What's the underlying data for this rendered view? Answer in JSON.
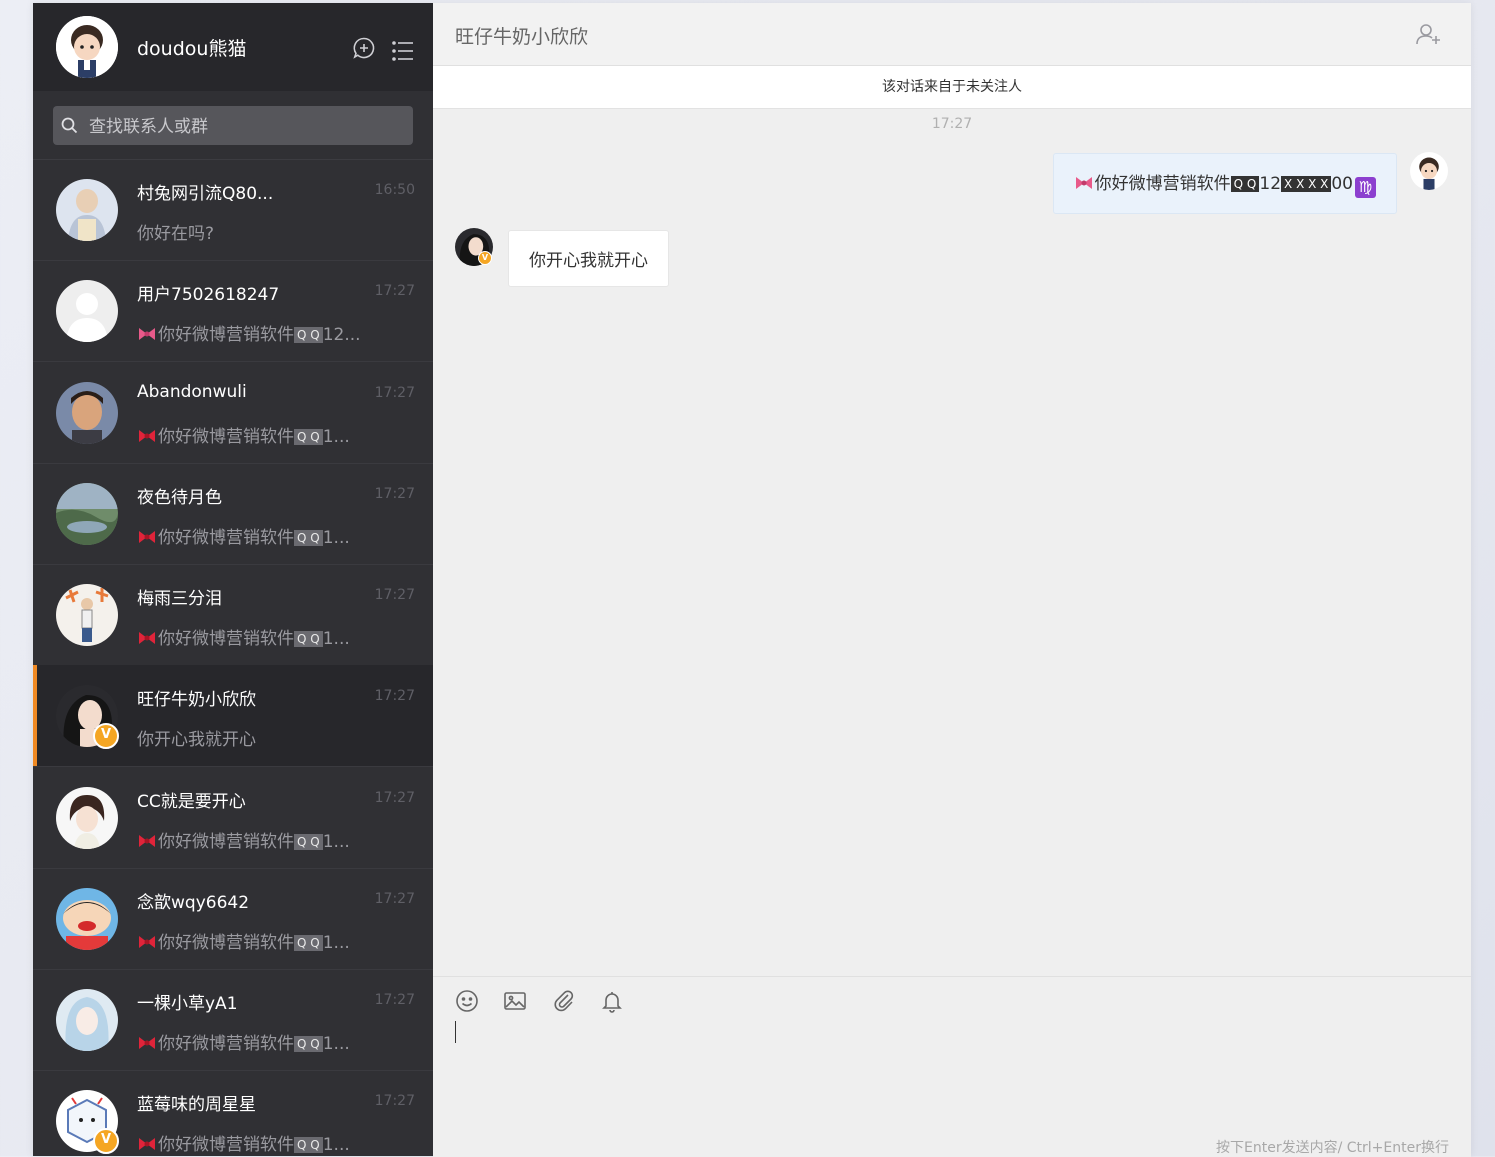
{
  "profile": {
    "name": "doudou熊猫"
  },
  "search": {
    "placeholder": "查找联系人或群"
  },
  "conversations": [
    {
      "name": "村兔网引流Q80...",
      "time": "16:50",
      "preview": "你好在吗?"
    },
    {
      "name": "用户7502618247",
      "time": "17:27",
      "preview": "你好微博营销软件",
      "preview_code": "Q Q",
      "preview_tail": "12..."
    },
    {
      "name": "Abandonwuli",
      "time": "17:27",
      "preview": "你好微博营销软件",
      "preview_code": "Q Q",
      "preview_tail": "1..."
    },
    {
      "name": "夜色待月色",
      "time": "17:27",
      "preview": "你好微博营销软件",
      "preview_code": "Q Q",
      "preview_tail": "1..."
    },
    {
      "name": "梅雨三分泪",
      "time": "17:27",
      "preview": "你好微博营销软件",
      "preview_code": "Q Q",
      "preview_tail": "1..."
    },
    {
      "name": "旺仔牛奶小欣欣",
      "time": "17:27",
      "preview": "你开心我就开心",
      "active": true,
      "verified": true
    },
    {
      "name": "CC就是要开心",
      "time": "17:27",
      "preview": "你好微博营销软件",
      "preview_code": "Q Q",
      "preview_tail": "1..."
    },
    {
      "name": "念歆wqy6642",
      "time": "17:27",
      "preview": "你好微博营销软件",
      "preview_code": "Q Q",
      "preview_tail": "1..."
    },
    {
      "name": "一棵小草yA1",
      "time": "17:27",
      "preview": "你好微博营销软件",
      "preview_code": "Q Q",
      "preview_tail": "1..."
    },
    {
      "name": "蓝莓味的周星星",
      "time": "17:27",
      "preview": "你好微博营销软件",
      "preview_code": "Q Q",
      "preview_tail": "1...",
      "verified": true
    }
  ],
  "chat": {
    "title": "旺仔牛奶小欣欣",
    "notice": "该对话来自于未关注人",
    "timestamp": "17:27",
    "outgoing": {
      "text": "你好微博营销软件",
      "code1": "Q Q",
      "mid": "12",
      "code2": "X X X X",
      "tail": "00",
      "emoji": "♍"
    },
    "incoming": {
      "text": "你开心我就开心"
    }
  },
  "composer": {
    "value": "",
    "hint": "按下Enter发送内容/ Ctrl+Enter换行"
  },
  "icons": [
    "new-chat-icon",
    "menu-icon",
    "search-icon",
    "add-member-icon",
    "emoji-icon",
    "image-icon",
    "attachment-icon",
    "bell-icon"
  ],
  "colors": {
    "sidebar": "#303034",
    "active_bar": "#f08a24",
    "verified": "#f5a623",
    "outgoing_bubble": "#eaf2fb"
  }
}
